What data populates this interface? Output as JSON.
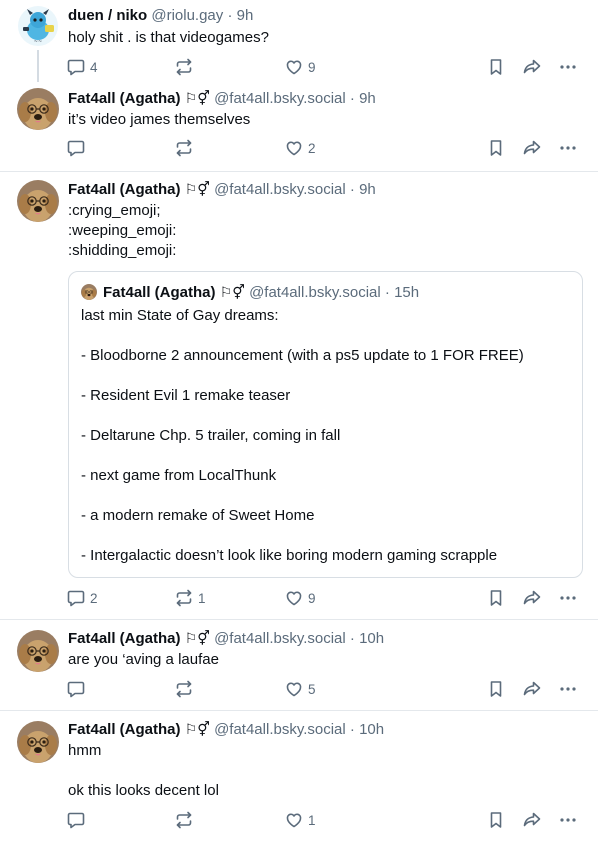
{
  "posts": [
    {
      "name": "duen / niko",
      "flags": "",
      "handle": "@riolu.gay",
      "time": "· 9h",
      "body": "holy shit . is that videogames?",
      "replies": "4",
      "reposts": "",
      "likes": "9"
    },
    {
      "name": "Fat4all (Agatha)",
      "flags": "⚐⚥",
      "handle": "@fat4all.bsky.social",
      "time": "· 9h",
      "body": "it’s video james themselves",
      "replies": "",
      "reposts": "",
      "likes": "2"
    },
    {
      "name": "Fat4all (Agatha)",
      "flags": "⚐⚥",
      "handle": "@fat4all.bsky.social",
      "time": "· 9h",
      "body": ":crying_emoji;\n:weeping_emoji:\n:shidding_emoji:",
      "replies": "2",
      "reposts": "1",
      "likes": "9",
      "quote": {
        "name": "Fat4all (Agatha)",
        "flags": "⚐⚥",
        "handle": "@fat4all.bsky.social",
        "time": "· 15h",
        "body": "last min State of Gay dreams:\n\n- Bloodborne 2 announcement (with a ps5 update to 1 FOR FREE)\n\n- Resident Evil 1 remake teaser\n\n- Deltarune Chp. 5 trailer, coming in fall\n\n- next game from LocalThunk\n\n- a modern remake of Sweet Home\n\n- Intergalactic doesn’t look like boring modern gaming scrapple"
      }
    },
    {
      "name": "Fat4all (Agatha)",
      "flags": "⚐⚥",
      "handle": "@fat4all.bsky.social",
      "time": "· 10h",
      "body": "are you ‘aving a laufae",
      "replies": "",
      "reposts": "",
      "likes": "5"
    },
    {
      "name": "Fat4all (Agatha)",
      "flags": "⚐⚥",
      "handle": "@fat4all.bsky.social",
      "time": "· 10h",
      "body": "hmm\n\nok this looks decent lol",
      "replies": "",
      "reposts": "",
      "likes": "1"
    }
  ],
  "colors": {
    "text": "#0b0f14",
    "muted": "#5b6b7b",
    "divider": "#e4e8ec"
  },
  "icons": [
    "reply-icon",
    "repost-icon",
    "like-icon",
    "bookmark-icon",
    "share-icon",
    "more-icon"
  ]
}
